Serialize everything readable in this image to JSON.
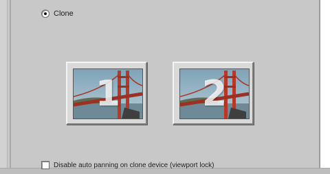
{
  "clone_option": {
    "label": "Clone",
    "selected": true
  },
  "monitors": [
    {
      "number": "1",
      "image_icon": "golden-gate-bridge-icon"
    },
    {
      "number": "2",
      "image_icon": "golden-gate-bridge-icon"
    }
  ],
  "disable_option": {
    "label": "Disable auto panning on clone device (viewport lock)",
    "checked": false
  },
  "colors": {
    "panel": "#c8c8c8",
    "bridge": "#b33a2a",
    "sky": "#8fb4c8"
  }
}
